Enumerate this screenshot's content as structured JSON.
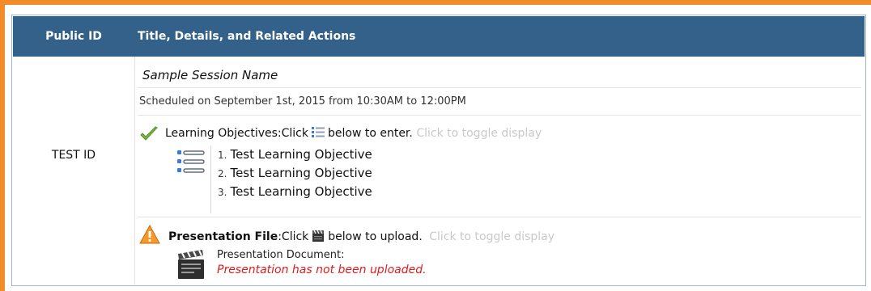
{
  "table": {
    "header": {
      "public_id": "Public ID",
      "title": "Title, Details, and Related Actions"
    },
    "row": {
      "public_id": "TEST ID",
      "session_name": "Sample Session Name",
      "schedule": "Scheduled on September 1st, 2015 from 10:30AM to 12:00PM",
      "learning_objectives": {
        "label": "Learning Objectives",
        "prefix": ":Click",
        "suffix": "below to enter.",
        "toggle": "Click to toggle display",
        "items": [
          {
            "num": "1.",
            "text": "Test Learning Objective"
          },
          {
            "num": "2.",
            "text": "Test Learning Objective"
          },
          {
            "num": "3.",
            "text": "Test Learning Objective"
          }
        ],
        "status_icon": "checkmark-icon"
      },
      "presentation_file": {
        "label": "Presentation File",
        "prefix": ":Click",
        "suffix": "below to upload.",
        "toggle": "Click to toggle display",
        "document_label": "Presentation Document:",
        "status": "Presentation has not been uploaded.",
        "status_icon": "warning-icon"
      }
    }
  },
  "colors": {
    "header_bg": "#336189",
    "frame_orange": "#f28c28",
    "error_red": "#e01b1b",
    "toggle_gray": "#c9c9c9",
    "check_green": "#7cb342"
  }
}
